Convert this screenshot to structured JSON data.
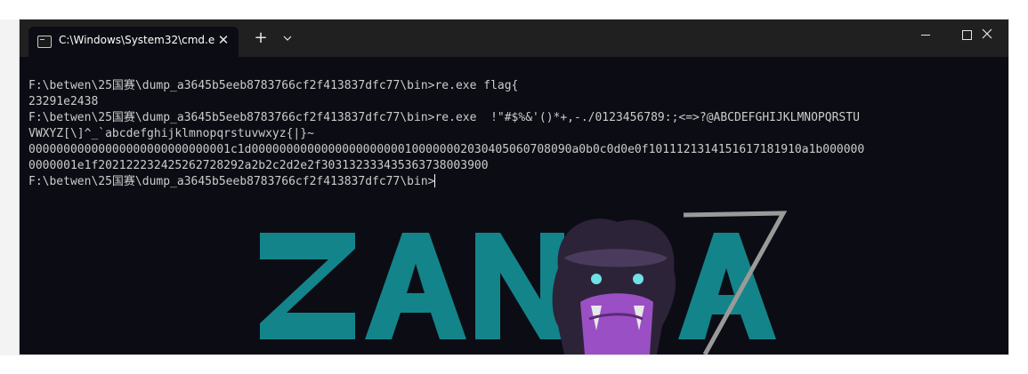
{
  "window": {
    "tab_title": "C:\\Windows\\System32\\cmd.e",
    "tab_close_glyph": "✕",
    "new_tab_glyph": "+",
    "icons": [
      "terminal-icon",
      "close-icon",
      "plus-icon",
      "chevron-down-icon",
      "minimize-icon",
      "maximize-icon",
      "close-icon"
    ]
  },
  "terminal": {
    "lines": [
      "F:\\betwen\\25国赛\\dump_a3645b5eeb8783766cf2f413837dfc77\\bin>re.exe flag{",
      "23291e2438",
      "F:\\betwen\\25国赛\\dump_a3645b5eeb8783766cf2f413837dfc77\\bin>re.exe  !\"#$%&'()*+,-./0123456789:;<=>?@ABCDEFGHIJKLMNOPQRSTU",
      "VWXYZ[\\]^_`abcdefghijklmnopqrstuvwxyz{|}~",
      "00000000000000000000000000001c1d0000000000000000000000100000002030405060708090a0b0c0d0e0f1011121314151617181910a1b000000",
      "0000001e1f202122232425262728292a2b2c2d2e2f303132333435363738003900",
      "F:\\betwen\\25国赛\\dump_a3645b5eeb8783766cf2f413837dfc77\\bin>"
    ]
  },
  "wallpaper": {
    "logo_text": "ZAN A",
    "accent_color": "#13848a",
    "mascot_color": "#9b4fc4",
    "mascot": "gorilla-mascot-icon"
  }
}
